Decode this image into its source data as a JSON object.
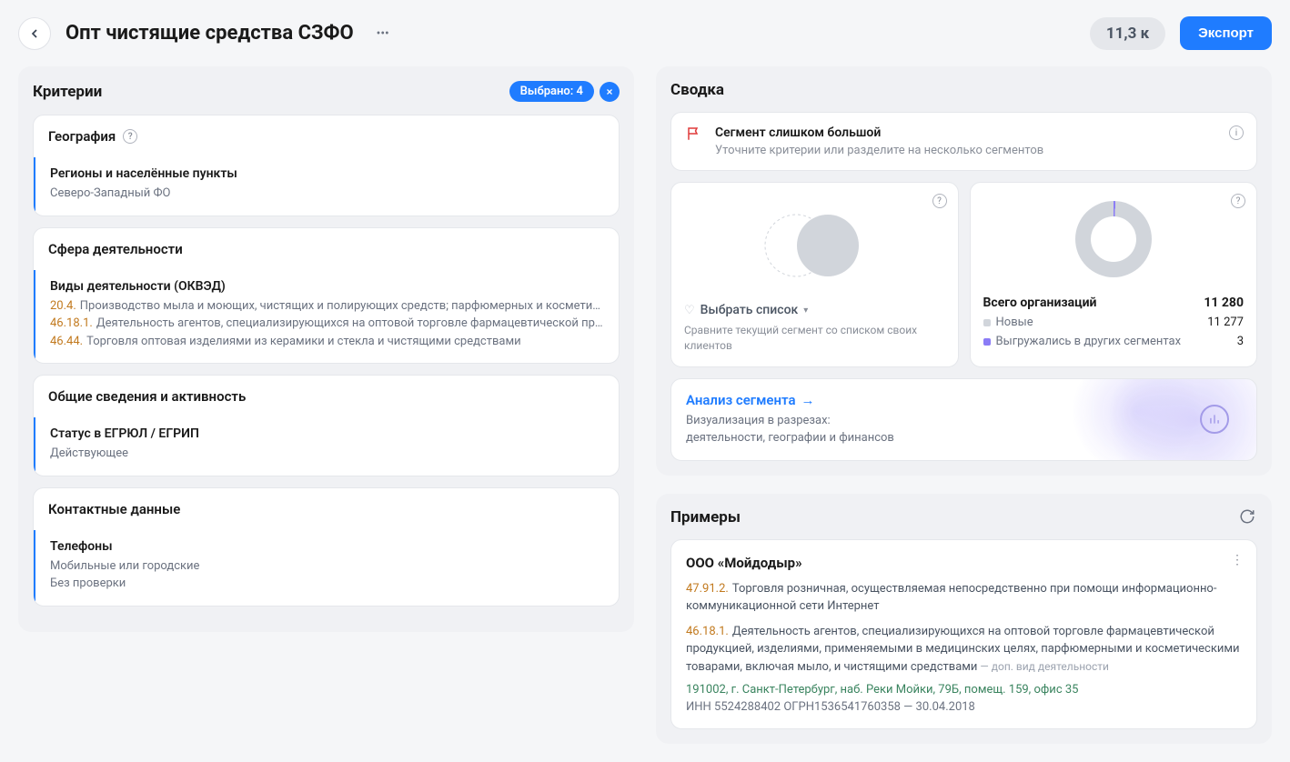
{
  "header": {
    "title": "Опт чистящие средства СЗФО",
    "count": "11,3 к",
    "export_label": "Экспорт"
  },
  "criteria": {
    "title": "Критерии",
    "selected_label": "Выбрано: 4",
    "groups": [
      {
        "title": "География",
        "has_help": true,
        "sections": [
          {
            "title": "Регионы и населённые пункты",
            "lines": [
              "Северо-Западный ФО"
            ]
          }
        ]
      },
      {
        "title": "Сфера деятельности",
        "has_help": false,
        "sections": [
          {
            "title": "Виды деятельности (ОКВЭД)",
            "coded_lines": [
              {
                "code": "20.4.",
                "text": "Производство мыла и моющих, чистящих и полирующих средств; парфюмерных и косметически…"
              },
              {
                "code": "46.18.1.",
                "text": "Деятельность агентов, специализирующихся на оптовой торговле фармацевтической продукц…"
              },
              {
                "code": "46.44.",
                "text": "Торговля оптовая изделиями из керамики и стекла и чистящими средствами"
              }
            ]
          }
        ]
      },
      {
        "title": "Общие сведения и активность",
        "has_help": false,
        "sections": [
          {
            "title": "Статус в ЕГРЮЛ / ЕГРИП",
            "lines": [
              "Действующее"
            ]
          }
        ]
      },
      {
        "title": "Контактные данные",
        "has_help": false,
        "sections": [
          {
            "title": "Телефоны",
            "lines": [
              "Мобильные или городские",
              "Без проверки"
            ]
          }
        ]
      }
    ]
  },
  "summary": {
    "title": "Сводка",
    "alert": {
      "title": "Сегмент слишком большой",
      "sub": "Уточните критерии или разделите на несколько сегментов"
    },
    "compare": {
      "select_label": "Выбрать список",
      "sub": "Сравните текущий сегмент со списком своих клиентов"
    },
    "stats": {
      "total_label": "Всего организаций",
      "total_value": "11 280",
      "rows": [
        {
          "label": "Новые",
          "value": "11 277",
          "dot": "grey"
        },
        {
          "label": "Выгружались в других сегментах",
          "value": "3",
          "dot": "purple"
        }
      ]
    },
    "analysis": {
      "link": "Анализ сегмента",
      "sub": "Визуализация в разрезах:\nдеятельности, географии и финансов"
    }
  },
  "examples": {
    "title": "Примеры",
    "item": {
      "name": "ООО «Мойдодыр»",
      "activities": [
        {
          "code": "47.91.2.",
          "text": "Торговля розничная, осуществляемая непосредственно при помощи информационно-коммуникационной сети Интернет",
          "note": ""
        },
        {
          "code": "46.18.1.",
          "text": "Деятельность агентов, специализирующихся на оптовой торговле фармацевтической продукцией, изделиями, применяемыми в медицинских целях, парфюмерными и косметическими товарами, включая мыло, и чистящими средствами",
          "note": " — доп. вид деятельности"
        }
      ],
      "address": "191002, г. Санкт-Петербург, наб. Реки Мойки, 79Б, помещ. 159, офис 35",
      "inn_label": "ИНН",
      "inn": "5524288402",
      "ogrn_label": "ОГРН",
      "ogrn": "1536541760358",
      "date": "30.04.2018"
    }
  },
  "chart_data": {
    "type": "pie",
    "title": "Всего организаций",
    "total": 11280,
    "series": [
      {
        "name": "Новые",
        "value": 11277
      },
      {
        "name": "Выгружались в других сегментах",
        "value": 3
      }
    ]
  }
}
